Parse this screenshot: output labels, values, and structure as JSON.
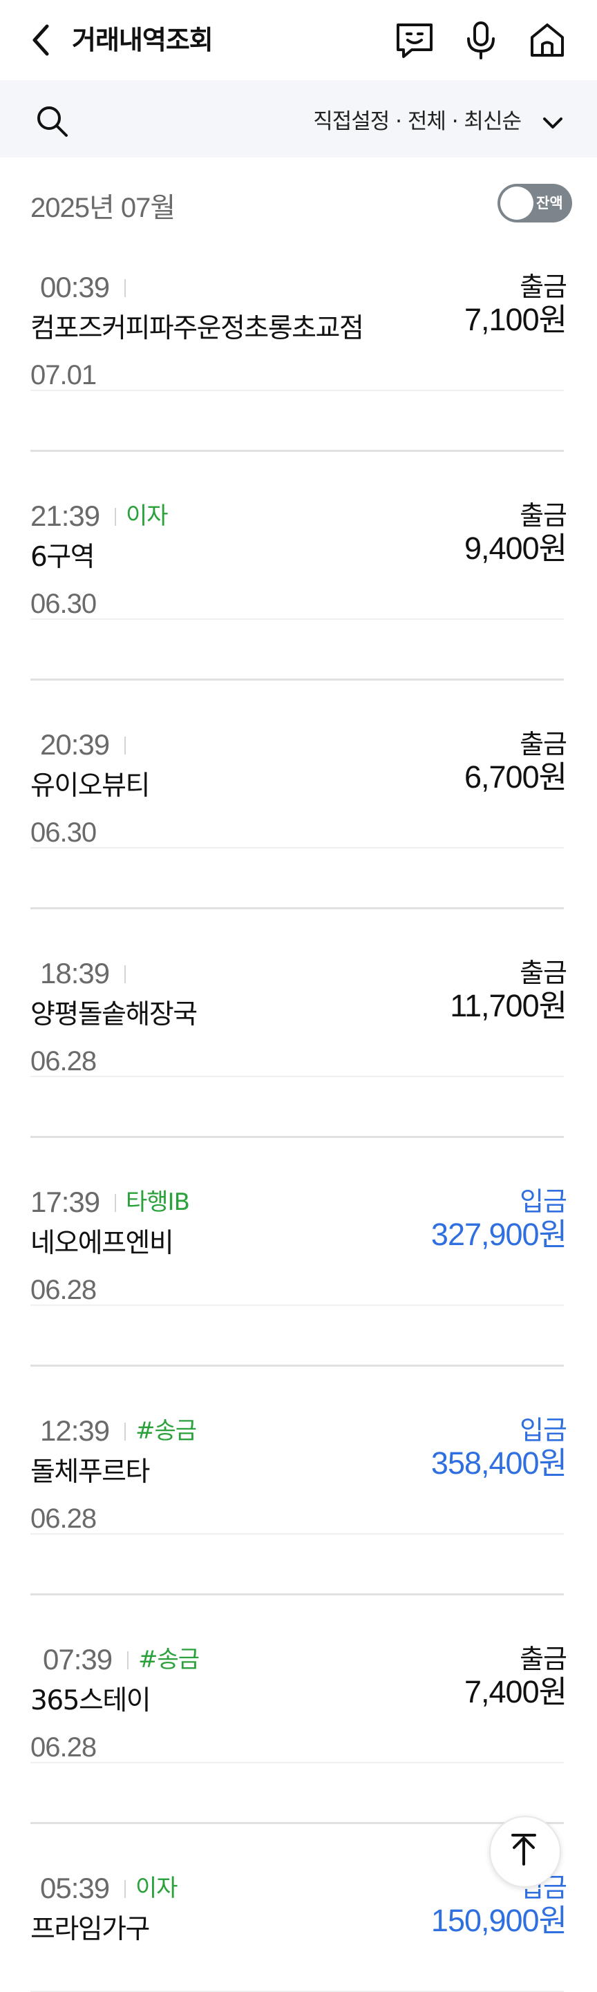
{
  "header": {
    "title": "거래내역조회",
    "icons": [
      "back-arrow-icon",
      "chatbot-icon",
      "microphone-icon",
      "home-icon"
    ]
  },
  "filter": {
    "summary": "직접설정 · 전체 · 최신순"
  },
  "month_label": "2025년 07월",
  "balance_toggle": {
    "label": "잔액",
    "on": false
  },
  "groups": [
    {
      "date": "",
      "items": [
        {
          "time": "00:39",
          "tag": "",
          "merchant": "컴포즈커피파주운정초롱초교점",
          "type": "출금",
          "amount": "7,100원",
          "kind": "withdrawal"
        }
      ]
    },
    {
      "date": "07.01",
      "items": [
        {
          "time": "21:39",
          "tag": "이자",
          "merchant": "6구역",
          "type": "출금",
          "amount": "9,400원",
          "kind": "withdrawal"
        }
      ]
    },
    {
      "date": "06.30",
      "items": [
        {
          "time": "20:39",
          "tag": "",
          "merchant": "유이오뷰티",
          "type": "출금",
          "amount": "6,700원",
          "kind": "withdrawal"
        }
      ]
    },
    {
      "date": "06.30",
      "items": [
        {
          "time": "18:39",
          "tag": "",
          "merchant": "양평돌솥해장국",
          "type": "출금",
          "amount": "11,700원",
          "kind": "withdrawal"
        }
      ]
    },
    {
      "date": "06.28",
      "items": [
        {
          "time": "17:39",
          "tag": "타행IB",
          "merchant": "네오에프엔비",
          "type": "입금",
          "amount": "327,900원",
          "kind": "deposit"
        }
      ]
    },
    {
      "date": "06.28",
      "items": [
        {
          "time": "12:39",
          "tag": "#송금",
          "merchant": "돌체푸르타",
          "type": "입금",
          "amount": "358,400원",
          "kind": "deposit"
        }
      ]
    },
    {
      "date": "06.28",
      "items": [
        {
          "time": "07:39",
          "tag": "#송금",
          "merchant": "365스테이",
          "type": "출금",
          "amount": "7,400원",
          "kind": "withdrawal"
        }
      ]
    },
    {
      "date": "06.28",
      "items": [
        {
          "time": "05:39",
          "tag": "이자",
          "merchant": "프라임가구",
          "type": "입금",
          "amount": "150,900원",
          "kind": "deposit"
        }
      ]
    }
  ],
  "colors": {
    "deposit": "#2f6fe0",
    "tag": "#2aa13a",
    "muted": "#6a6a6a",
    "filter_bg": "#f4f6fa"
  },
  "scroll_top_icon": "arrow-up-icon"
}
